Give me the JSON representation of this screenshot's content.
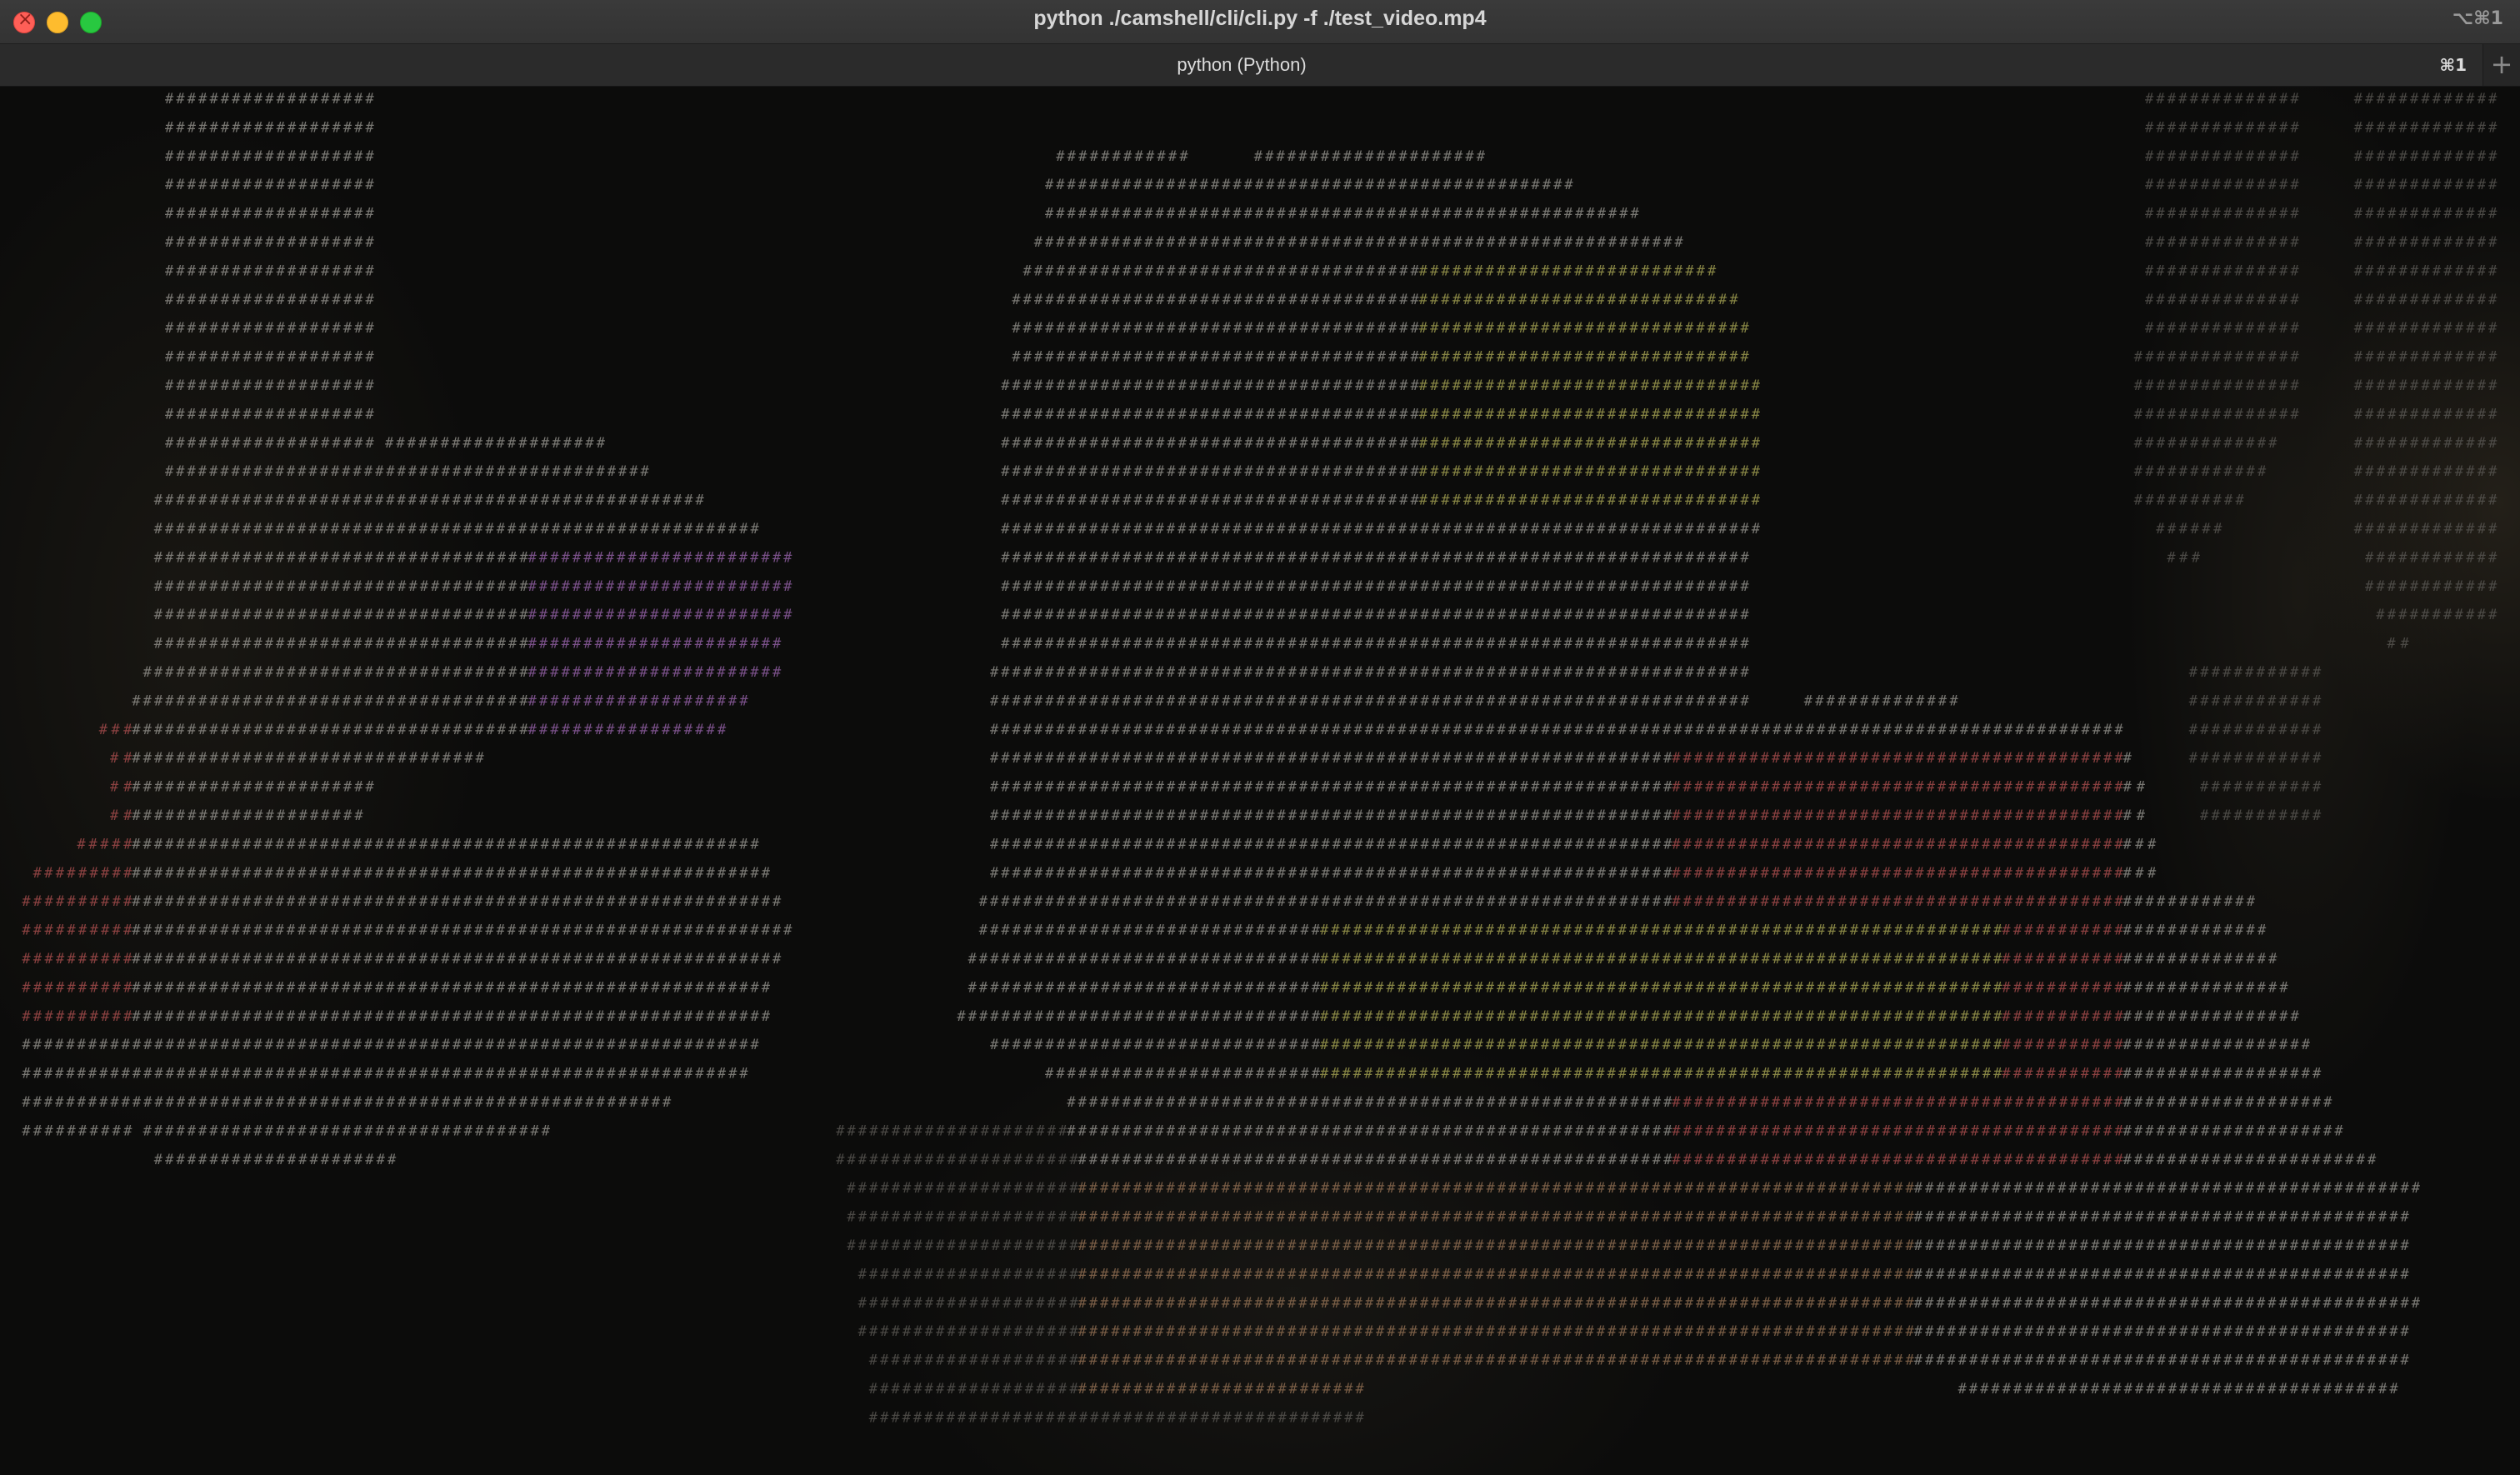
{
  "window": {
    "title": "python ./camshell/cli/cli.py -f ./test_video.mp4",
    "shortcut": "⌥⌘1"
  },
  "tab": {
    "label": "python (Python)",
    "shortcut": "⌘1",
    "new_tab_symbol": "+"
  },
  "terminal": {
    "content": "ascii-art video frame",
    "glyphs": [
      "#",
      ":",
      "."
    ],
    "colors": {
      "base": "#8d8b86",
      "dim": "#55534f",
      "olive": "#9c9a4e",
      "purple": "#8d5c9e",
      "red": "#a04a4a",
      "brown": "#8a6a4f"
    }
  }
}
